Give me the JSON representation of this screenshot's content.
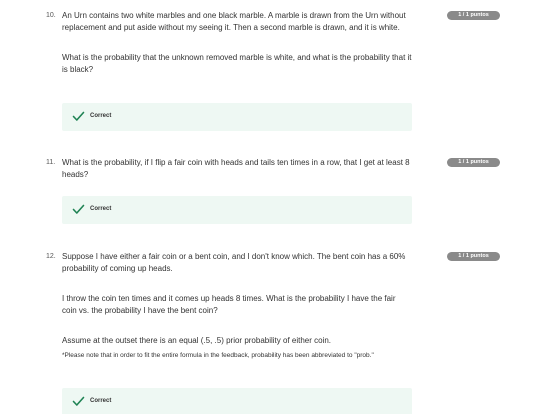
{
  "questions": [
    {
      "number": "10.",
      "badge": "1 / 1 puntos",
      "paragraphs": [
        "An Urn contains two white marbles and one black marble. A marble is drawn from the Urn without replacement and put aside without my seeing it. Then a second marble is drawn, and it is white.",
        "What is the probability that the unknown removed marble is white, and what is the probability that it is black?"
      ],
      "result": "Correct"
    },
    {
      "number": "11.",
      "badge": "1 / 1 puntos",
      "paragraphs": [
        "What is the probability, if I flip a fair coin with heads and tails ten times in a row, that I get at least 8 heads?"
      ],
      "result": "Correct"
    },
    {
      "number": "12.",
      "badge": "1 / 1 puntos",
      "paragraphs": [
        "Suppose I have either a fair coin or a bent coin, and I don't know which. The bent coin has a 60% probability of coming up heads.",
        "I throw the coin ten times and it comes up heads 8 times. What is the probability I have the fair coin vs. the probability I have the bent coin?",
        "Assume at the outset there is an equal (.5, .5) prior probability of either coin."
      ],
      "note": "*Please note that in order to fit the entire formula in the feedback, probability has been abbreviated to \"prob.\"",
      "result": "Correct"
    }
  ],
  "colors": {
    "badge_bg": "#8a8a8a",
    "correct_bg": "#eef8f3",
    "check_green": "#1f8354"
  },
  "icons": {
    "check": "check-icon"
  }
}
